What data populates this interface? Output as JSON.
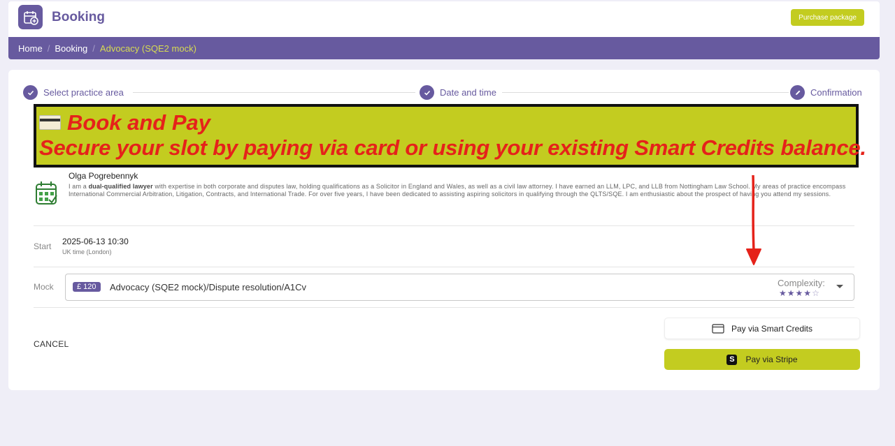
{
  "header": {
    "title": "Booking",
    "purchase_label": "Purchase package"
  },
  "breadcrumb": {
    "items": [
      "Home",
      "Booking"
    ],
    "current": "Advocacy (SQE2 mock)"
  },
  "stepper": {
    "steps": [
      "Select practice area",
      "Date and time",
      "Confirmation"
    ]
  },
  "banner": {
    "icon": "credit-card-icon",
    "title": "Book and Pay",
    "subtitle": "Secure your slot by paying via card or using your existing Smart Credits balance."
  },
  "tutor": {
    "name": "Olga Pogrebennyk",
    "bio_prefix": "I am a ",
    "bio_bold": "dual-qualified lawyer",
    "bio_rest": " with expertise in both corporate and disputes law, holding qualifications as a Solicitor in England and Wales, as well as a civil law attorney. I have earned an LLM, LPC, and LLB from Nottingham Law School. My areas of practice encompass International Commercial Arbitration, Litigation, Contracts, and International Trade. For over five years, I have been dedicated to assisting aspiring solicitors in qualifying through the QLTS/SQE. I am enthusiastic about the prospect of having you attend my sessions."
  },
  "start": {
    "label": "Start",
    "datetime": "2025-06-13 10:30",
    "timezone": "UK time (London)"
  },
  "mock": {
    "label": "Mock",
    "price": "£ 120",
    "value": "Advocacy (SQE2 mock)/Dispute resolution/A1Cv",
    "complexity_label": "Complexity:",
    "complexity_rating": 4,
    "complexity_max": 5
  },
  "actions": {
    "cancel": "CANCEL",
    "smart_credits": "Pay via Smart Credits",
    "stripe": "Pay via Stripe"
  },
  "colors": {
    "brand": "#675a9f",
    "accent": "#c3cc20",
    "annotation": "#e5221a"
  }
}
